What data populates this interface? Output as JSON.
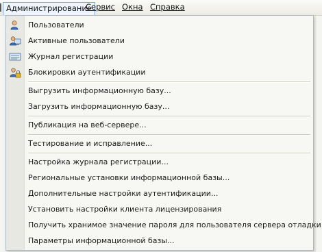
{
  "menubar": {
    "items": [
      {
        "label": "Администрирование",
        "active": true
      },
      {
        "label": "Сервис",
        "active": false
      },
      {
        "label": "Окна",
        "active": false
      },
      {
        "label": "Справка",
        "active": false
      }
    ]
  },
  "menu": {
    "items": [
      {
        "label": "Пользователи",
        "icon": "user-icon"
      },
      {
        "label": "Активные пользователи",
        "icon": "active-users-icon"
      },
      {
        "label": "Журнал регистрации",
        "icon": "log-icon"
      },
      {
        "label": "Блокировки аутентификации",
        "icon": "user-lock-icon"
      },
      {
        "label": "Выгрузить информационную базу..."
      },
      {
        "label": "Загрузить информационную базу..."
      },
      {
        "label": "Публикация на веб-сервере..."
      },
      {
        "label": "Тестирование и исправление..."
      },
      {
        "label": "Настройка журнала регистрации..."
      },
      {
        "label": "Региональные установки информационной базы..."
      },
      {
        "label": "Дополнительные настройки аутентификации..."
      },
      {
        "label": "Установить настройки клиента лицензирования"
      },
      {
        "label": "Получить хранимое значение пароля для пользователя сервера отладки..."
      },
      {
        "label": "Параметры информационной базы..."
      }
    ]
  },
  "colors": {
    "active_item_border": "#7ea4d6",
    "active_item_bg": "#eef5fe",
    "menu_bg": "#f7f7f4",
    "gutter_bg": "#e8e8e2"
  }
}
